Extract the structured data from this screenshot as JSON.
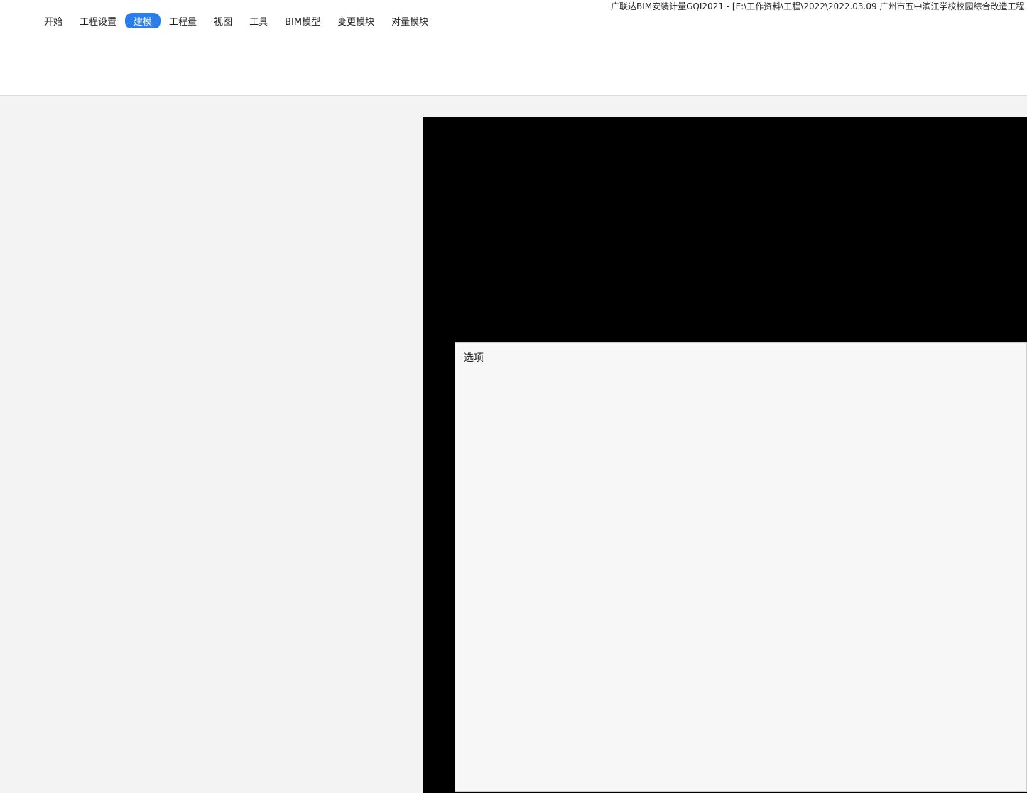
{
  "window": {
    "title": "广联达BIM安装计量GQI2021 - [E:\\工作资料\\工程\\2022\\2022.03.09 广州市五中滨江学校校园综合改造工程"
  },
  "tabs": [
    {
      "label": "开始"
    },
    {
      "label": "工程设置"
    },
    {
      "label": "建模"
    },
    {
      "label": "工程量"
    },
    {
      "label": "视图"
    },
    {
      "label": "工具"
    },
    {
      "label": "BIM模型"
    },
    {
      "label": "变更模块"
    },
    {
      "label": "对量模块"
    }
  ],
  "dialog": {
    "title": "选项"
  }
}
